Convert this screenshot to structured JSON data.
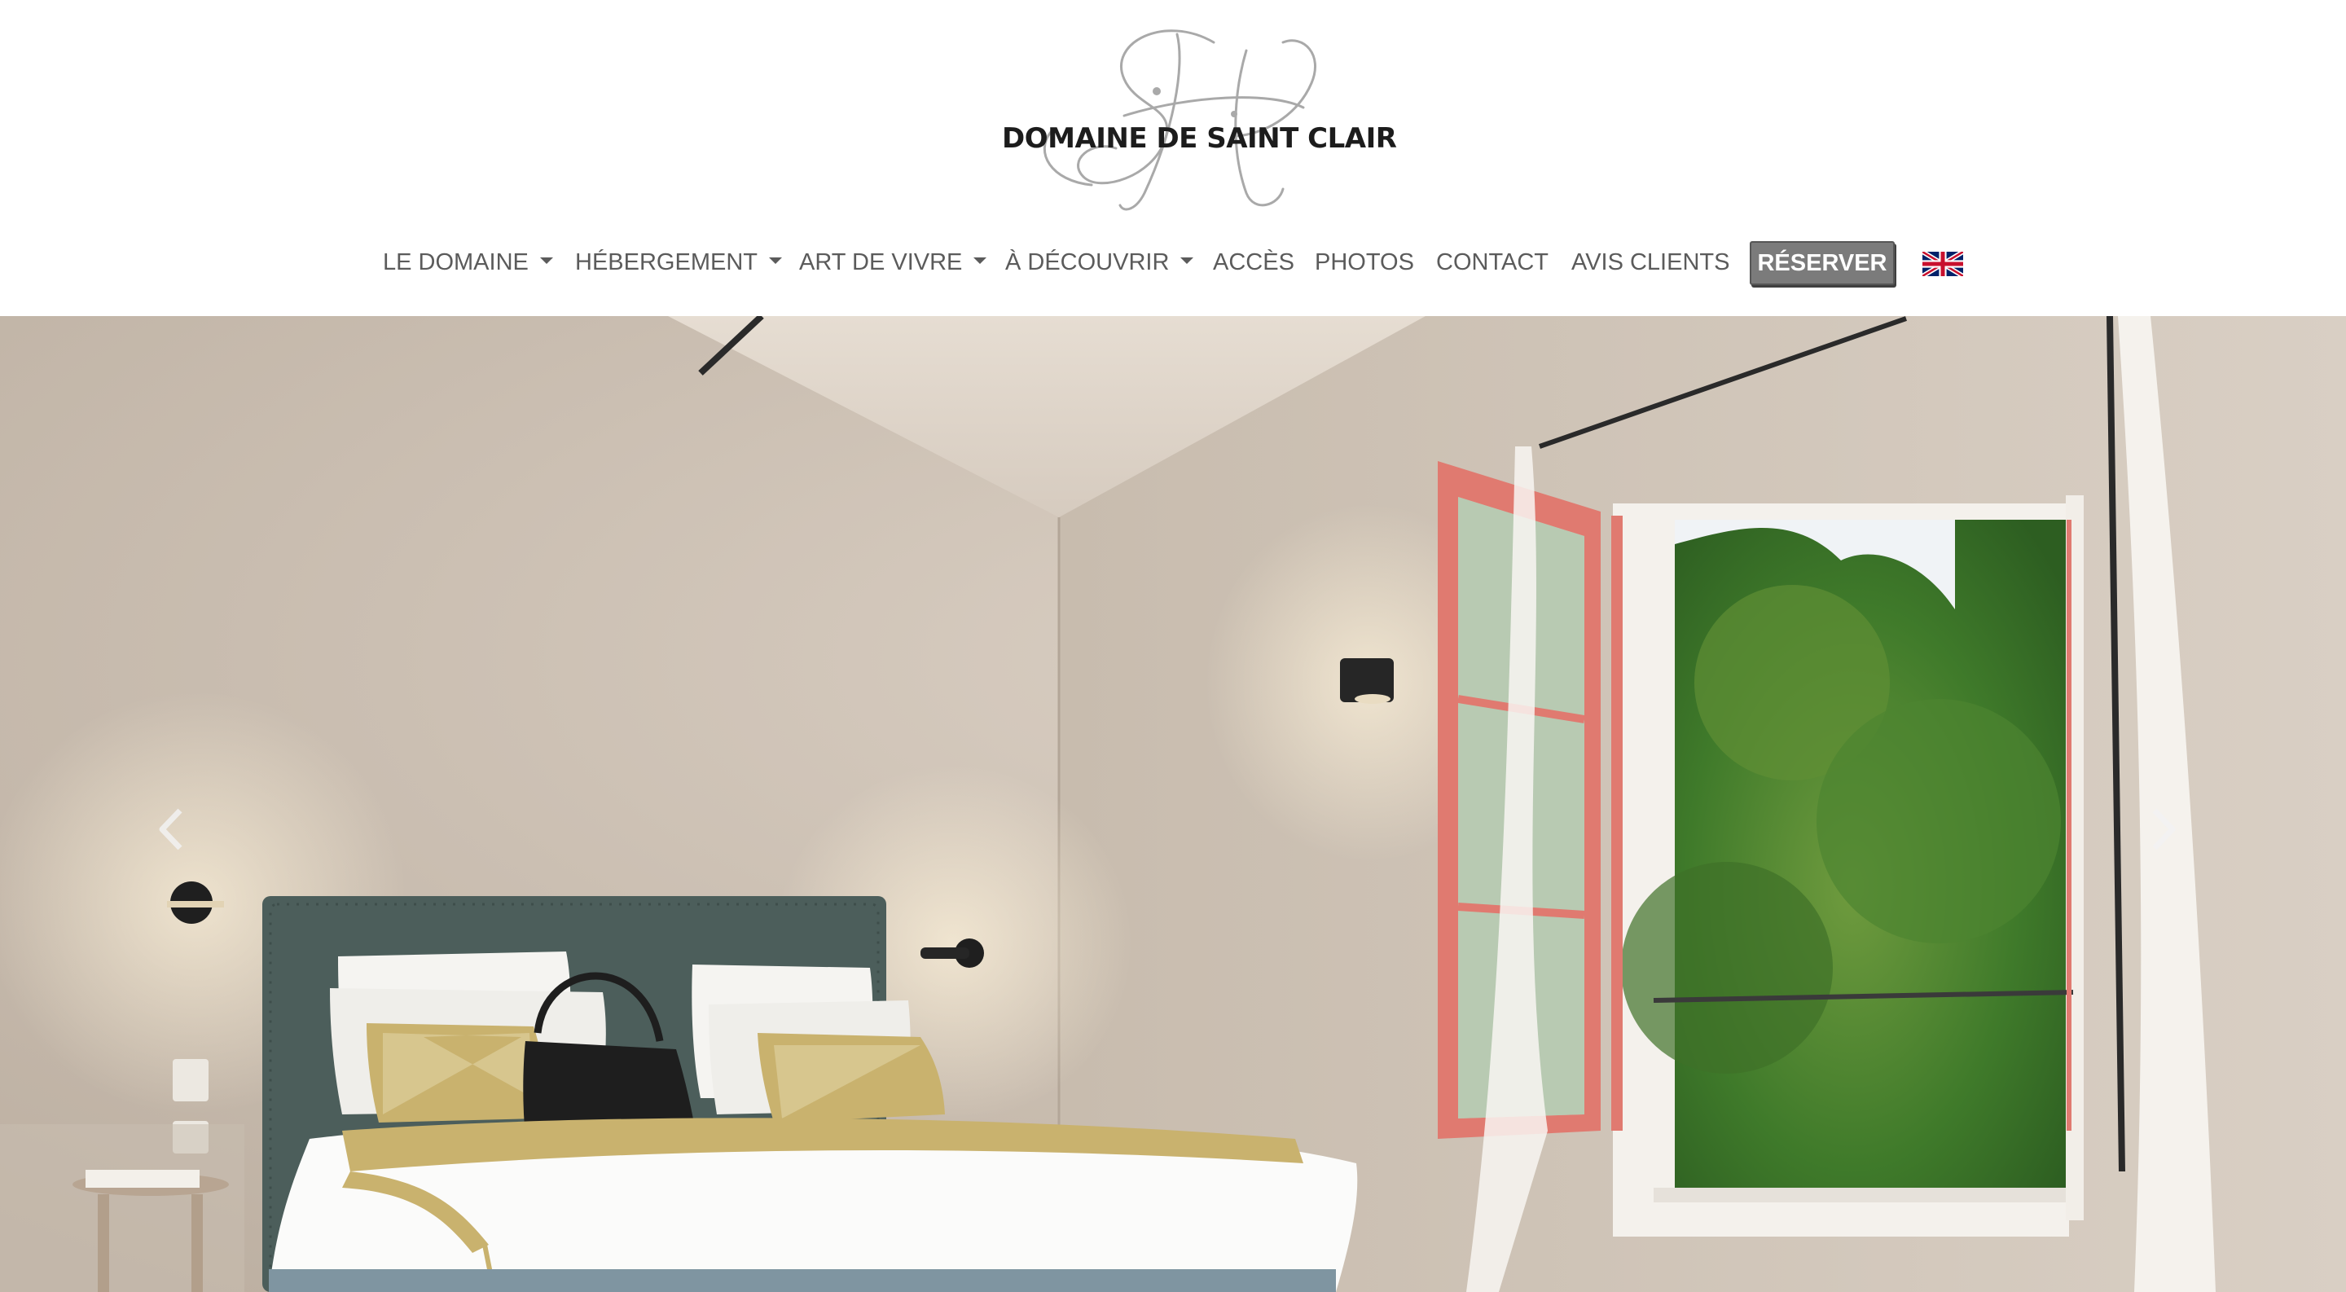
{
  "brand": {
    "name": "DOMAINE DE SAINT CLAIR",
    "monogram_icon": "sc-monogram-logo"
  },
  "nav": {
    "items": [
      {
        "label": "LE DOMAINE",
        "dropdown": true
      },
      {
        "label": "HÉBERGEMENT",
        "dropdown": true
      },
      {
        "label": "ART DE VIVRE",
        "dropdown": true
      },
      {
        "label": "À DÉCOUVRIR",
        "dropdown": true
      },
      {
        "label": "ACCÈS",
        "dropdown": false
      },
      {
        "label": "PHOTOS",
        "dropdown": false
      },
      {
        "label": "CONTACT",
        "dropdown": false
      },
      {
        "label": "AVIS CLIENTS",
        "dropdown": false
      }
    ],
    "reserve_label": "RÉSERVER",
    "language_icon": "uk-flag-icon"
  },
  "hero": {
    "image_icon": "bedroom-photo",
    "prev_icon": "chevron-left-icon",
    "next_icon": "chevron-right-icon"
  },
  "colors": {
    "nav_text": "#5b5b5b",
    "reserve_bg": "#7b7b7b",
    "wall": "#cfc4b8",
    "window_frame": "#e07a70",
    "headboard": "#4c5e5b",
    "throw": "#c9b26e"
  }
}
